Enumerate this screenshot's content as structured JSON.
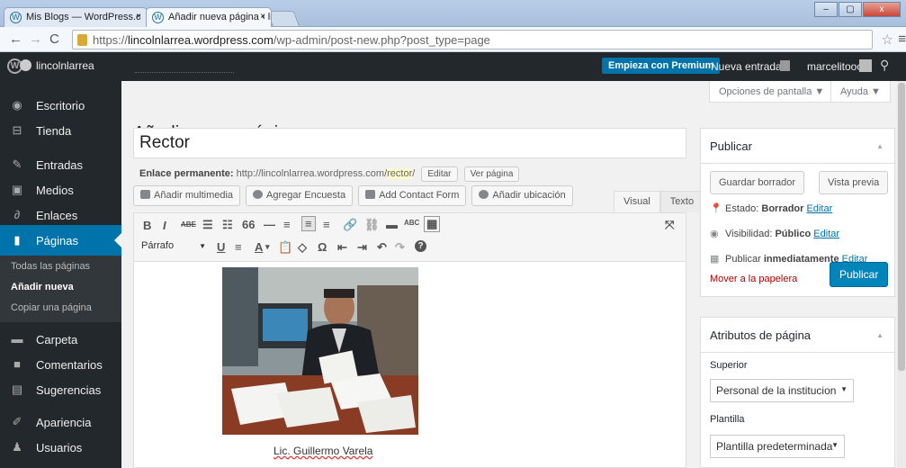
{
  "browser": {
    "tabs": [
      {
        "label": "Mis Blogs — WordPress.c",
        "active": false
      },
      {
        "label": "Añadir nueva página ‹ linc",
        "active": true
      }
    ],
    "url_scheme": "https://",
    "url_host": "lincolnlarrea.wordpress.com",
    "url_path": "/wp-admin/post-new.php?post_type=page",
    "window_buttons": [
      "–",
      "▢",
      "x"
    ]
  },
  "adminbar": {
    "site_name": "lincolnlarrea",
    "premium_label": "Empieza con Premium",
    "new_post": "Nueva entrada",
    "username": "marcelitooo"
  },
  "sidebar": {
    "items": [
      {
        "label": "Escritorio",
        "icon": "dashboard-icon"
      },
      {
        "label": "Tienda",
        "icon": "cart-icon"
      },
      {
        "label": "Entradas",
        "icon": "pin-icon"
      },
      {
        "label": "Medios",
        "icon": "media-icon"
      },
      {
        "label": "Enlaces",
        "icon": "link-icon"
      },
      {
        "label": "Páginas",
        "icon": "page-icon"
      },
      {
        "label": "Carpeta",
        "icon": "folder-icon"
      },
      {
        "label": "Comentarios",
        "icon": "comment-icon"
      },
      {
        "label": "Sugerencias",
        "icon": "feedback-icon"
      },
      {
        "label": "Apariencia",
        "icon": "brush-icon"
      },
      {
        "label": "Usuarios",
        "icon": "users-icon"
      }
    ],
    "submenu": [
      "Todas las páginas",
      "Añadir nueva",
      "Copiar una página"
    ]
  },
  "screen_options": "Opciones de pantalla ▼",
  "help": "Ayuda ▼",
  "page_title": "Añadir nueva página",
  "post_title": "Rector",
  "permalink": {
    "label": "Enlace permanente:",
    "url": "http://lincolnlarrea.wordpress.com/",
    "slug": "rector",
    "edit": "Editar",
    "view": "Ver página"
  },
  "media_buttons": [
    "Añadir multimedia",
    "Agregar Encuesta",
    "Add Contact Form",
    "Añadir ubicación"
  ],
  "editor_tabs": [
    "Visual",
    "Texto"
  ],
  "toolbar": {
    "row1": [
      "B",
      "I",
      "ABE",
      "☰",
      "☷",
      "66",
      "—",
      "≡",
      "≡",
      "≡",
      "🔗",
      "⛓",
      "▬",
      "ABC",
      "▦"
    ],
    "row2": [
      "U",
      "≡",
      "A",
      "▾",
      "📋",
      "◇",
      "Ω",
      "⇤",
      "⇥",
      "↶",
      "↷",
      "?"
    ],
    "format": "Párrafo",
    "expand": "⤧"
  },
  "content": {
    "caption": "Lic. Guillermo Varela"
  },
  "publish_box": {
    "title": "Publicar",
    "save_draft": "Guardar borrador",
    "preview": "Vista previa",
    "status_label": "Estado:",
    "status_value": "Borrador",
    "status_edit": "Editar",
    "visibility_label": "Visibilidad:",
    "visibility_value": "Público",
    "visibility_edit": "Editar",
    "publish_label": "Publicar",
    "publish_value": "inmediatamente",
    "publish_edit": "Editar",
    "trash": "Mover a la papelera",
    "publish_button": "Publicar"
  },
  "attributes_box": {
    "title": "Atributos de página",
    "parent_label": "Superior",
    "parent_value": "Personal de la institucion",
    "template_label": "Plantilla",
    "template_value": "Plantilla predeterminada"
  }
}
